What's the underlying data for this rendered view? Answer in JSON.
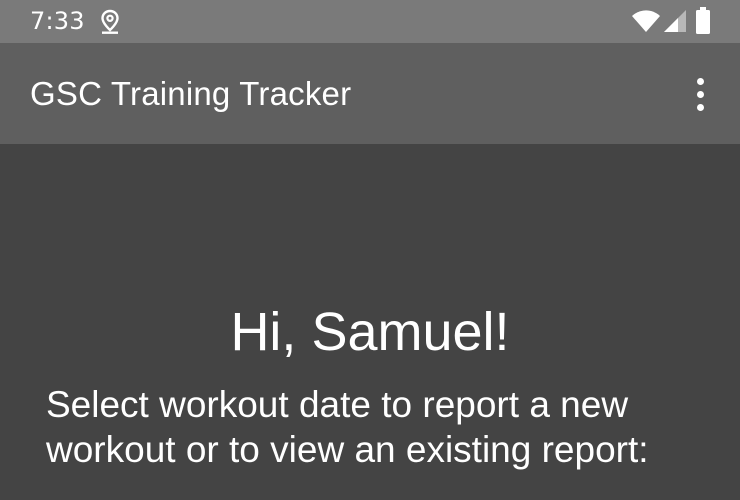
{
  "status_bar": {
    "time": "7:33",
    "icons": [
      "location-icon",
      "wifi-icon",
      "signal-icon",
      "battery-icon"
    ]
  },
  "app_bar": {
    "title": "GSC Training Tracker",
    "menu_icon": "more-vert-icon"
  },
  "main": {
    "greeting": "Hi, Samuel!",
    "instructions": "Select workout date to report a new workout or to view an existing report:"
  },
  "colors": {
    "status_bar_bg": "#7a7a7a",
    "app_bar_bg": "#5f5f5f",
    "content_bg": "#444444",
    "text": "#ffffff"
  }
}
